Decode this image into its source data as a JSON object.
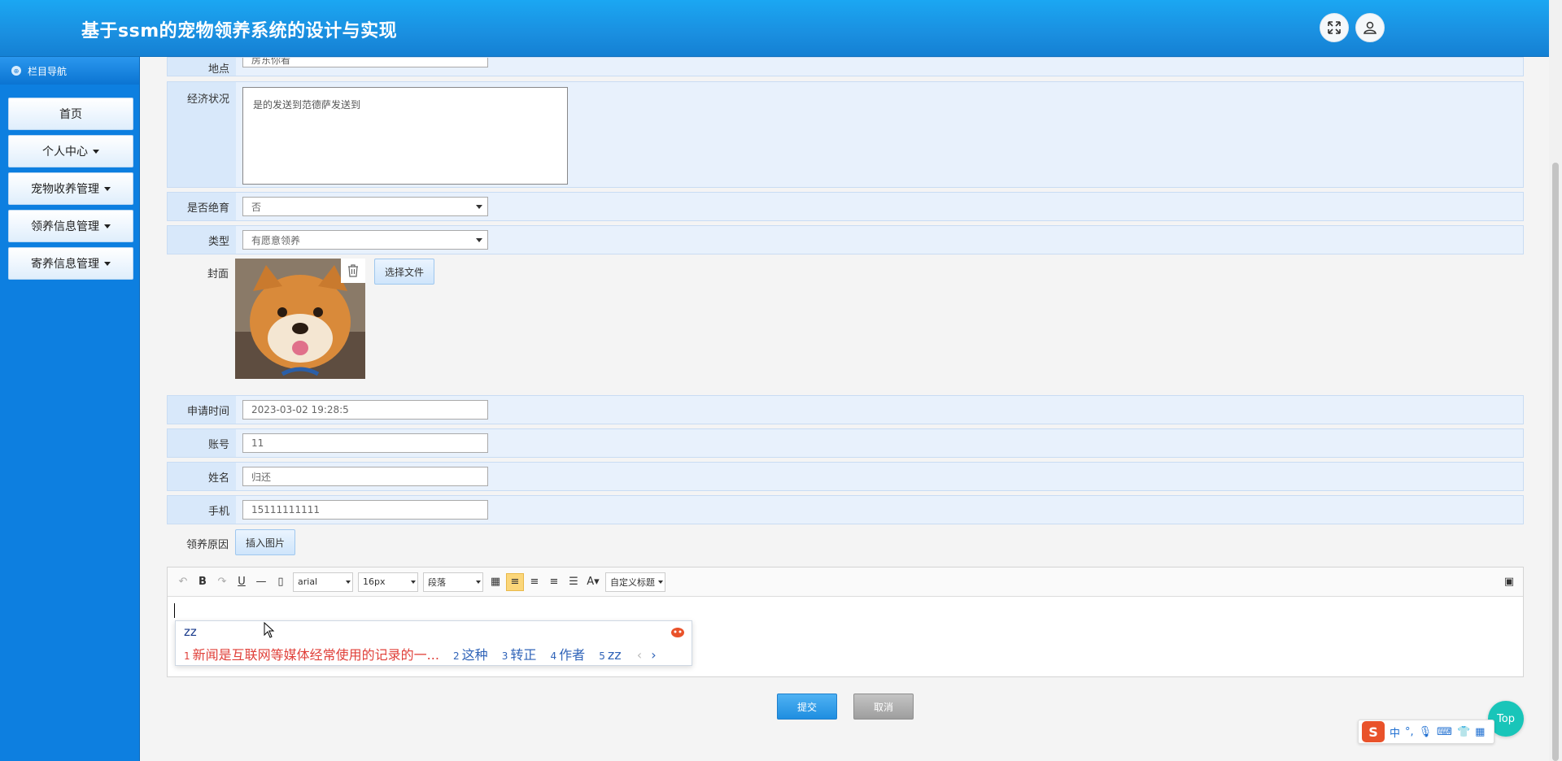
{
  "header": {
    "title": "基于ssm的宠物领养系统的设计与实现"
  },
  "sidebar": {
    "heading": "栏目导航",
    "items": [
      {
        "label": "首页"
      },
      {
        "label": "个人中心"
      },
      {
        "label": "宠物收养管理"
      },
      {
        "label": "领养信息管理"
      },
      {
        "label": "寄养信息管理"
      }
    ]
  },
  "form": {
    "location": {
      "label": "地点",
      "value": "房东你看"
    },
    "economy": {
      "label": "经济状况",
      "value": "是的发送到范德萨发送到"
    },
    "sterilized": {
      "label": "是否绝育",
      "value": "否"
    },
    "type": {
      "label": "类型",
      "value": "有愿意领养"
    },
    "cover": {
      "label": "封面",
      "choose_label": "选择文件"
    },
    "apply_time": {
      "label": "申请时间",
      "value": "2023-03-02 19:28:5"
    },
    "account": {
      "label": "账号",
      "value": "11"
    },
    "name": {
      "label": "姓名",
      "value": "归还"
    },
    "phone": {
      "label": "手机",
      "value": "15111111111"
    },
    "reason": {
      "label": "领养原因",
      "insert_image_label": "插入图片"
    }
  },
  "editor": {
    "font_family": "arial",
    "font_size": "16px",
    "paragraph": "段落",
    "custom_title": "自定义标题"
  },
  "ime": {
    "composition": "zz",
    "candidates": [
      {
        "num": "1",
        "text": "新闻是互联网等媒体经常使用的记录的一..."
      },
      {
        "num": "2",
        "text": "这种"
      },
      {
        "num": "3",
        "text": "转正"
      },
      {
        "num": "4",
        "text": "作者"
      },
      {
        "num": "5",
        "text": "zz"
      }
    ],
    "tray": {
      "logo": "S",
      "lang": "中"
    }
  },
  "actions": {
    "submit": "提交",
    "cancel": "取消",
    "top": "Top"
  }
}
